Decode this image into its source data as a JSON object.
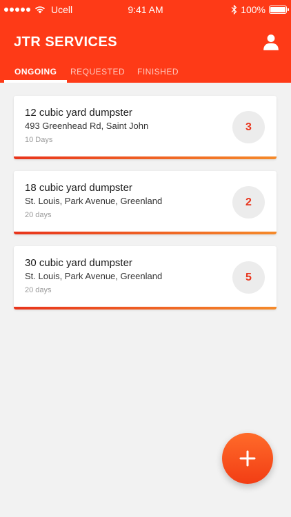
{
  "status_bar": {
    "carrier": "Ucell",
    "time": "9:41 AM",
    "battery": "100%"
  },
  "app": {
    "title": "JTR SERVICES",
    "accent_color": "#fe3a17"
  },
  "tabs": [
    {
      "label": "ONGOING",
      "active": true
    },
    {
      "label": "REQUESTED",
      "active": false
    },
    {
      "label": "FINISHED",
      "active": false
    }
  ],
  "orders": [
    {
      "title": "12 cubic yard dumpster",
      "address": "493 Greenhead Rd, Saint John",
      "duration": "10 Days",
      "count": "3"
    },
    {
      "title": "18 cubic yard dumpster",
      "address": "St. Louis, Park Avenue, Greenland",
      "duration": "20 days",
      "count": "2"
    },
    {
      "title": "30 cubic yard dumpster",
      "address": "St. Louis, Park Avenue, Greenland",
      "duration": "20 days",
      "count": "5"
    }
  ],
  "icons": {
    "profile": "person-icon",
    "fab": "plus-icon"
  }
}
